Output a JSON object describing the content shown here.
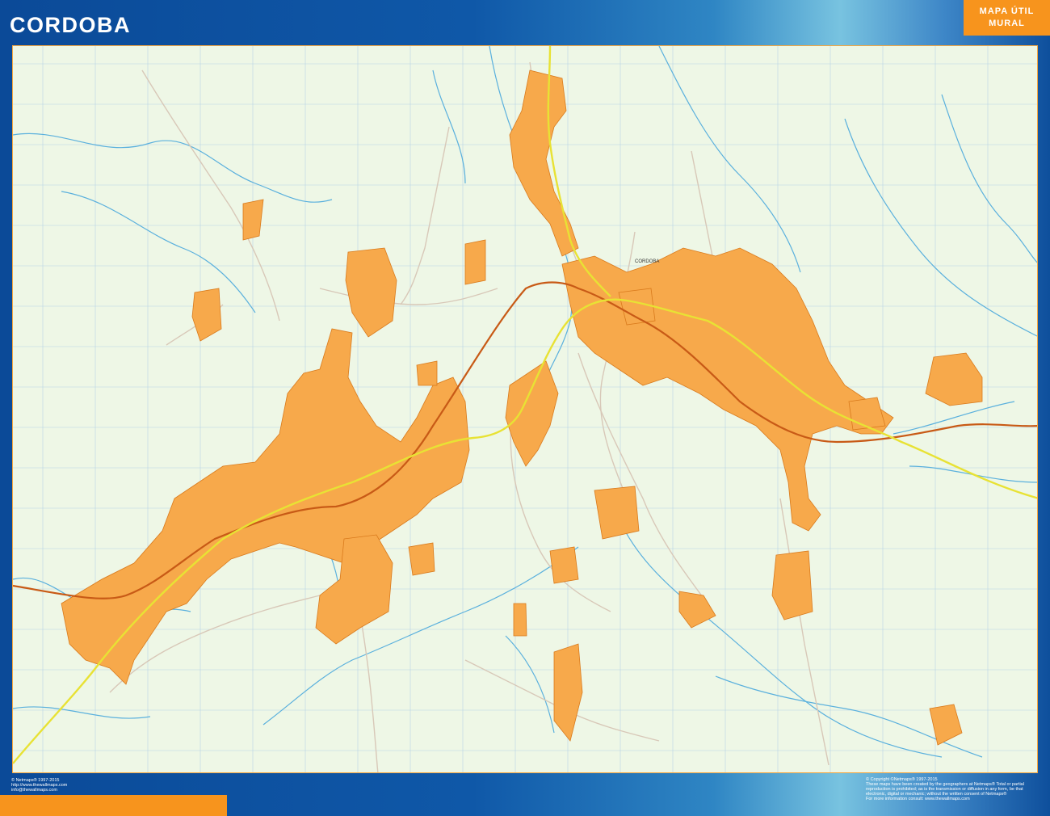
{
  "header": {
    "title": "CORDOBA",
    "badge_line1": "MAPA ÚTIL",
    "badge_line2": "MURAL"
  },
  "map": {
    "city": "CORDOBA",
    "colors": {
      "background": "#eef7e6",
      "urban_area": "#f7a94b",
      "urban_outline": "#d97a1c",
      "highway": "#e8e234",
      "railway": "#c85a16",
      "river": "#5ab0dd",
      "road": "#d8c8b8",
      "grid": "#b7d3e6"
    },
    "labels": [
      {
        "id": "cordoba",
        "text": "CORDOBA"
      }
    ]
  },
  "footer": {
    "left": [
      "© Netmaps® 1997-2015",
      "http://www.thewallmaps.com",
      "info@thewallmaps.com"
    ],
    "right": [
      "© Copyright ©Netmaps® 1997-2015",
      "These maps have been created by the geographers at Netmaps® Total or partial",
      "reproduction is prohibited; as is the transmission or diffusion in any form, be that",
      "electronic, digital or mechanic; without the written consent of Netmaps®",
      "For more information consult: www.thewallmaps.com"
    ]
  }
}
